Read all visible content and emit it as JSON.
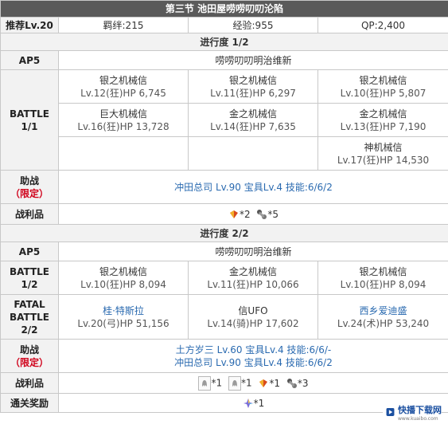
{
  "title": "第三节 池田屋唠唠叨叨沦陷",
  "header": {
    "recommend": "推荐Lv.20",
    "bond": "羁绊:215",
    "exp": "经验:955",
    "qp": "QP:2,400"
  },
  "stage1": {
    "progress": "进行度 1/2",
    "ap_label": "AP5",
    "quest_name": "唠唠叨叨明治维新",
    "battle_label": [
      "BATTLE",
      "1/1"
    ],
    "enemies": [
      [
        {
          "name": "银之机械信",
          "stat": "Lv.12(狂)HP 6,745"
        },
        {
          "name": "银之机械信",
          "stat": "Lv.11(狂)HP 6,297"
        },
        {
          "name": "银之机械信",
          "stat": "Lv.10(狂)HP 5,807"
        }
      ],
      [
        {
          "name": "巨大机械信",
          "stat": "Lv.16(狂)HP 13,728"
        },
        {
          "name": "金之机械信",
          "stat": "Lv.14(狂)HP 7,635"
        },
        {
          "name": "金之机械信",
          "stat": "Lv.13(狂)HP 7,190"
        }
      ],
      [
        {
          "name": "",
          "stat": ""
        },
        {
          "name": "",
          "stat": ""
        },
        {
          "name": "神机械信",
          "stat": "Lv.17(狂)HP 14,530"
        }
      ]
    ],
    "support_label": "助战",
    "support_limited": "（限定）",
    "support": [
      "冲田总司 Lv.90 宝具Lv.4 技能:6/6/2"
    ],
    "drops_label": "战利品",
    "drops": [
      {
        "icon": "gem-icon",
        "count": "*2"
      },
      {
        "icon": "bone-icon",
        "count": "*5"
      }
    ]
  },
  "stage2": {
    "progress": "进行度 2/2",
    "ap_label": "AP5",
    "quest_name": "唠唠叨叨明治维新",
    "battle1_label": [
      "BATTLE",
      "1/2"
    ],
    "battle1": [
      {
        "name": "银之机械信",
        "stat": "Lv.10(狂)HP 8,094"
      },
      {
        "name": "金之机械信",
        "stat": "Lv.11(狂)HP 10,066"
      },
      {
        "name": "银之机械信",
        "stat": "Lv.10(狂)HP 8,094"
      }
    ],
    "battle2_label": [
      "FATAL",
      "BATTLE",
      "2/2"
    ],
    "battle2": [
      {
        "name": "桂·特斯拉",
        "stat": "Lv.20(弓)HP 51,156"
      },
      {
        "name": "信UFO",
        "stat": "Lv.14(骑)HP 17,602"
      },
      {
        "name": "西乡爱迪盛",
        "stat": "Lv.24(术)HP 53,240"
      }
    ],
    "support_label": "助战",
    "support_limited": "（限定）",
    "support": [
      "土方岁三 Lv.60 宝具Lv.4 技能:6/6/-",
      "冲田总司 Lv.90 宝具Lv.4 技能:6/6/2"
    ],
    "drops_label": "战利品",
    "drops": [
      {
        "icon": "ghost-card-icon",
        "count": "*1"
      },
      {
        "icon": "ghost-card-icon",
        "count": "*1"
      },
      {
        "icon": "gem-icon",
        "count": "*1"
      },
      {
        "icon": "bone-icon",
        "count": "*3"
      }
    ],
    "reward_label": "通关奖励",
    "reward": {
      "icon": "saint-quartz-icon",
      "count": "*1"
    }
  },
  "watermark": {
    "text": "快播下载网",
    "sub": "www.kuaibo.com"
  },
  "colors": {
    "title_bg": "#5a5a5a",
    "label_bg": "#f2f2f2",
    "support_text": "#2a6ab0",
    "limited_text": "#d0021b",
    "border": "#c8c8c8"
  }
}
